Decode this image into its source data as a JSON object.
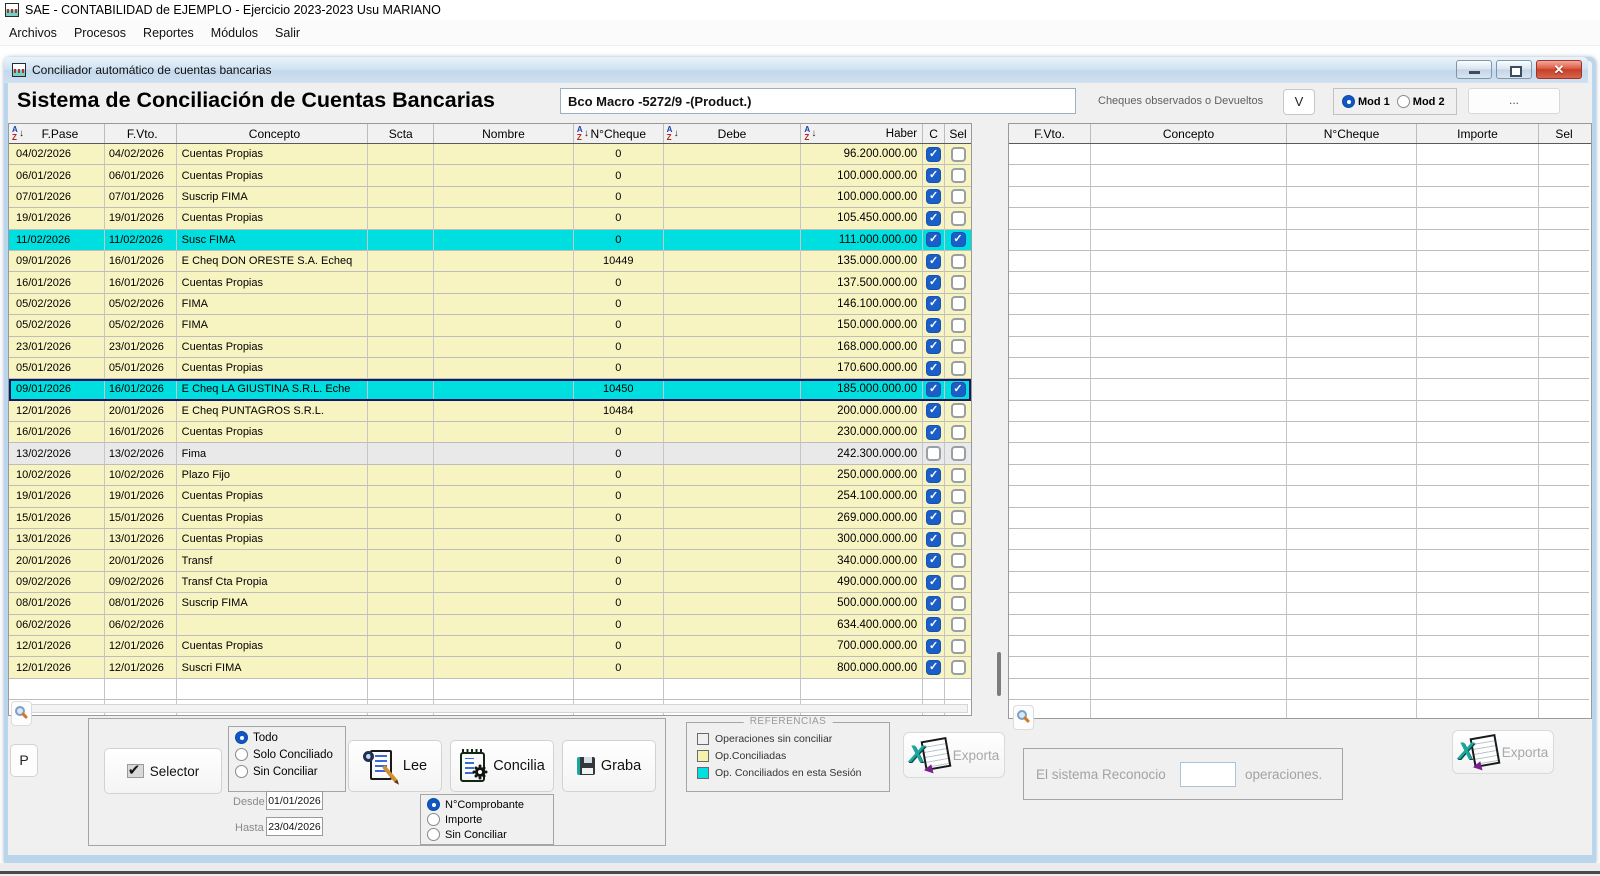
{
  "app": {
    "title": "SAE - CONTABILIDAD  de EJEMPLO - Ejercicio 2023-2023  Usu MARIANO",
    "menu": [
      "Archivos",
      "Procesos",
      "Reportes",
      "Módulos",
      "Salir"
    ]
  },
  "win": {
    "title": "Conciliador automático de cuentas bancarias",
    "heading": "Sistema de Conciliación de Cuentas Bancarias",
    "account": "Bco Macro -5272/9 -(Product.)",
    "cheques_label": "Cheques observados o Devueltos",
    "v_button": "V",
    "mod1": "Mod 1",
    "mod2": "Mod 2",
    "mod_selected": "Mod 1",
    "dots_button": "..."
  },
  "left_grid": {
    "headers": [
      "F.Pase",
      "F.Vto.",
      "Concepto",
      "Scta",
      "Nombre",
      "N°Cheque",
      "Debe",
      "Haber",
      "C",
      "Sel"
    ],
    "rows": [
      {
        "f_pase": "04/02/2026",
        "f_vto": "04/02/2026",
        "concepto": "Cuentas Propias",
        "scta": "",
        "nombre": "",
        "n_cheque": "0",
        "debe": "",
        "haber": "96.200.000.00",
        "c": true,
        "sel": false,
        "estado": "conciliada"
      },
      {
        "f_pase": "06/01/2026",
        "f_vto": "06/01/2026",
        "concepto": "Cuentas Propias",
        "scta": "",
        "nombre": "",
        "n_cheque": "0",
        "debe": "",
        "haber": "100.000.000.00",
        "c": true,
        "sel": false,
        "estado": "conciliada"
      },
      {
        "f_pase": "07/01/2026",
        "f_vto": "07/01/2026",
        "concepto": "Suscrip FIMA",
        "scta": "",
        "nombre": "",
        "n_cheque": "0",
        "debe": "",
        "haber": "100.000.000.00",
        "c": true,
        "sel": false,
        "estado": "conciliada"
      },
      {
        "f_pase": "19/01/2026",
        "f_vto": "19/01/2026",
        "concepto": "Cuentas Propias",
        "scta": "",
        "nombre": "",
        "n_cheque": "0",
        "debe": "",
        "haber": "105.450.000.00",
        "c": true,
        "sel": false,
        "estado": "conciliada"
      },
      {
        "f_pase": "11/02/2026",
        "f_vto": "11/02/2026",
        "concepto": "Susc FIMA",
        "scta": "",
        "nombre": "",
        "n_cheque": "0",
        "debe": "",
        "haber": "111.000.000.00",
        "c": true,
        "sel": true,
        "estado": "sesion"
      },
      {
        "f_pase": "09/01/2026",
        "f_vto": "16/01/2026",
        "concepto": "E Cheq DON ORESTE S.A. Echeq",
        "scta": "",
        "nombre": "",
        "n_cheque": "10449",
        "debe": "",
        "haber": "135.000.000.00",
        "c": true,
        "sel": false,
        "estado": "conciliada"
      },
      {
        "f_pase": "16/01/2026",
        "f_vto": "16/01/2026",
        "concepto": "Cuentas Propias",
        "scta": "",
        "nombre": "",
        "n_cheque": "0",
        "debe": "",
        "haber": "137.500.000.00",
        "c": true,
        "sel": false,
        "estado": "conciliada"
      },
      {
        "f_pase": "05/02/2026",
        "f_vto": "05/02/2026",
        "concepto": "FIMA",
        "scta": "",
        "nombre": "",
        "n_cheque": "0",
        "debe": "",
        "haber": "146.100.000.00",
        "c": true,
        "sel": false,
        "estado": "conciliada"
      },
      {
        "f_pase": "05/02/2026",
        "f_vto": "05/02/2026",
        "concepto": "FIMA",
        "scta": "",
        "nombre": "",
        "n_cheque": "0",
        "debe": "",
        "haber": "150.000.000.00",
        "c": true,
        "sel": false,
        "estado": "conciliada"
      },
      {
        "f_pase": "23/01/2026",
        "f_vto": "23/01/2026",
        "concepto": "Cuentas Propias",
        "scta": "",
        "nombre": "",
        "n_cheque": "0",
        "debe": "",
        "haber": "168.000.000.00",
        "c": true,
        "sel": false,
        "estado": "conciliada"
      },
      {
        "f_pase": "05/01/2026",
        "f_vto": "05/01/2026",
        "concepto": "Cuentas Propias",
        "scta": "",
        "nombre": "",
        "n_cheque": "0",
        "debe": "",
        "haber": "170.600.000.00",
        "c": true,
        "sel": false,
        "estado": "conciliada"
      },
      {
        "f_pase": "09/01/2026",
        "f_vto": "16/01/2026",
        "concepto": "E Cheq LA GIUSTINA S.R.L. Eche",
        "scta": "",
        "nombre": "",
        "n_cheque": "10450",
        "debe": "",
        "haber": "185.000.000.00",
        "c": true,
        "sel": true,
        "estado": "sesion",
        "focused": true
      },
      {
        "f_pase": "12/01/2026",
        "f_vto": "20/01/2026",
        "concepto": "E Cheq PUNTAGROS S.R.L.",
        "scta": "",
        "nombre": "",
        "n_cheque": "10484",
        "debe": "",
        "haber": "200.000.000.00",
        "c": true,
        "sel": false,
        "estado": "conciliada"
      },
      {
        "f_pase": "16/01/2026",
        "f_vto": "16/01/2026",
        "concepto": "Cuentas Propias",
        "scta": "",
        "nombre": "",
        "n_cheque": "0",
        "debe": "",
        "haber": "230.000.000.00",
        "c": true,
        "sel": false,
        "estado": "conciliada"
      },
      {
        "f_pase": "13/02/2026",
        "f_vto": "13/02/2026",
        "concepto": "Fima",
        "scta": "",
        "nombre": "",
        "n_cheque": "0",
        "debe": "",
        "haber": "242.300.000.00",
        "c": false,
        "sel": false,
        "estado": "sin"
      },
      {
        "f_pase": "10/02/2026",
        "f_vto": "10/02/2026",
        "concepto": "Plazo Fijo",
        "scta": "",
        "nombre": "",
        "n_cheque": "0",
        "debe": "",
        "haber": "250.000.000.00",
        "c": true,
        "sel": false,
        "estado": "conciliada"
      },
      {
        "f_pase": "19/01/2026",
        "f_vto": "19/01/2026",
        "concepto": "Cuentas Propias",
        "scta": "",
        "nombre": "",
        "n_cheque": "0",
        "debe": "",
        "haber": "254.100.000.00",
        "c": true,
        "sel": false,
        "estado": "conciliada"
      },
      {
        "f_pase": "15/01/2026",
        "f_vto": "15/01/2026",
        "concepto": "Cuentas Propias",
        "scta": "",
        "nombre": "",
        "n_cheque": "0",
        "debe": "",
        "haber": "269.000.000.00",
        "c": true,
        "sel": false,
        "estado": "conciliada"
      },
      {
        "f_pase": "13/01/2026",
        "f_vto": "13/01/2026",
        "concepto": "Cuentas Propias",
        "scta": "",
        "nombre": "",
        "n_cheque": "0",
        "debe": "",
        "haber": "300.000.000.00",
        "c": true,
        "sel": false,
        "estado": "conciliada"
      },
      {
        "f_pase": "20/01/2026",
        "f_vto": "20/01/2026",
        "concepto": "Transf",
        "scta": "",
        "nombre": "",
        "n_cheque": "0",
        "debe": "",
        "haber": "340.000.000.00",
        "c": true,
        "sel": false,
        "estado": "conciliada"
      },
      {
        "f_pase": "09/02/2026",
        "f_vto": "09/02/2026",
        "concepto": "Transf Cta Propia",
        "scta": "",
        "nombre": "",
        "n_cheque": "0",
        "debe": "",
        "haber": "490.000.000.00",
        "c": true,
        "sel": false,
        "estado": "conciliada"
      },
      {
        "f_pase": "08/01/2026",
        "f_vto": "08/01/2026",
        "concepto": "Suscrip FIMA",
        "scta": "",
        "nombre": "",
        "n_cheque": "0",
        "debe": "",
        "haber": "500.000.000.00",
        "c": true,
        "sel": false,
        "estado": "conciliada"
      },
      {
        "f_pase": "06/02/2026",
        "f_vto": "06/02/2026",
        "concepto": "",
        "scta": "",
        "nombre": "",
        "n_cheque": "0",
        "debe": "",
        "haber": "634.400.000.00",
        "c": true,
        "sel": false,
        "estado": "conciliada"
      },
      {
        "f_pase": "12/01/2026",
        "f_vto": "12/01/2026",
        "concepto": "Cuentas Propias",
        "scta": "",
        "nombre": "",
        "n_cheque": "0",
        "debe": "",
        "haber": "700.000.000.00",
        "c": true,
        "sel": false,
        "estado": "conciliada"
      },
      {
        "f_pase": "12/01/2026",
        "f_vto": "12/01/2026",
        "concepto": "Suscri FIMA",
        "scta": "",
        "nombre": "",
        "n_cheque": "0",
        "debe": "",
        "haber": "800.000.000.00",
        "c": true,
        "sel": false,
        "estado": "conciliada"
      }
    ]
  },
  "right_grid": {
    "headers": [
      "F.Vto.",
      "Concepto",
      "N°Cheque",
      "Importe",
      "Sel"
    ]
  },
  "panel": {
    "p_button": "P",
    "selector": "Selector",
    "filter": {
      "options": [
        "Todo",
        "Solo Conciliado",
        "Sin Conciliar"
      ],
      "selected": "Todo"
    },
    "desde_label": "Desde",
    "desde": "01/01/2026",
    "hasta_label": "Hasta",
    "hasta": "23/04/2026",
    "lee": "Lee",
    "concilia": "Concilia",
    "graba": "Graba",
    "match": {
      "options": [
        "N°Comprobante",
        "Importe",
        "Sin Conciliar"
      ],
      "selected": "N°Comprobante"
    }
  },
  "referencias": {
    "title": "REFERENCIAS",
    "items": [
      {
        "color": "#f0f0f0",
        "label": "Operaciones sin conciliar"
      },
      {
        "color": "#f6f2ad",
        "label": "Op.Conciliadas"
      },
      {
        "color": "#00e0e0",
        "label": "Op. Conciliados en esta Sesión"
      }
    ]
  },
  "exporta_label": "Exporta",
  "recognition": {
    "prefix": "El sistema Reconocio",
    "value": "",
    "suffix": "operaciones."
  },
  "colors": {
    "row_conciliada": "#f8f4c2",
    "row_sesion": "#00dfdf",
    "row_sin_conciliar": "#e9e9e9",
    "checkbox_on": "#1b5ec8",
    "titlebar_blue": "#cfe1f2",
    "close_button_red": "#c73d27"
  }
}
